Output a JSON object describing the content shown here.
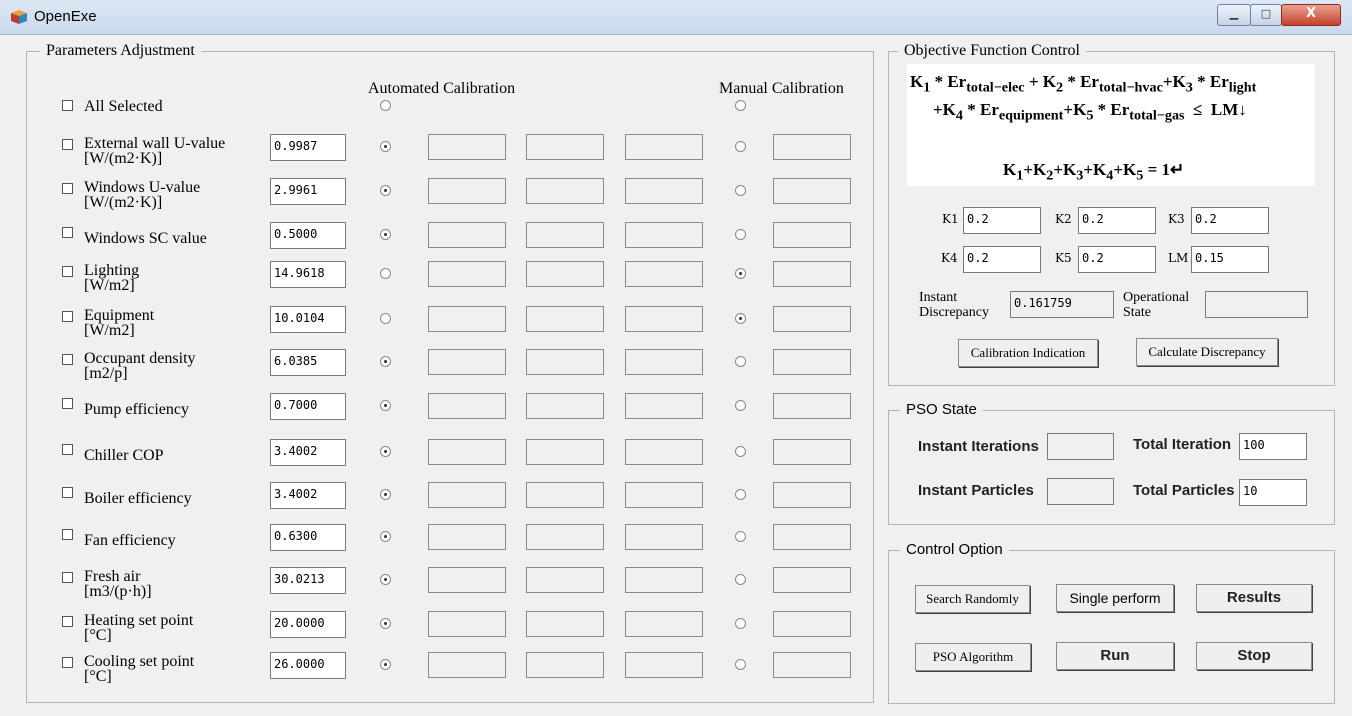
{
  "window": {
    "title": "OpenExe",
    "min_glyph": "▁",
    "max_glyph": "□",
    "close_glyph": "X"
  },
  "params": {
    "group_title": "Parameters Adjustment",
    "auto_header": "Automated Calibration",
    "manual_header": "Manual Calibration",
    "all_selected": "All Selected",
    "rows": [
      {
        "label": "External wall U-value",
        "unit": "[W/(m2·K)]",
        "value": "0.9987",
        "auto": true
      },
      {
        "label": "Windows U-value",
        "unit": "[W/(m2·K)]",
        "value": "2.9961",
        "auto": true
      },
      {
        "label": "Windows SC value",
        "unit": "",
        "value": "0.5000",
        "auto": true
      },
      {
        "label": "Lighting",
        "unit": "[W/m2]",
        "value": "14.9618",
        "auto": false
      },
      {
        "label": "Equipment",
        "unit": "[W/m2]",
        "value": "10.0104",
        "auto": false
      },
      {
        "label": "Occupant density",
        "unit": "[m2/p]",
        "value": "6.0385",
        "auto": true
      },
      {
        "label": "Pump efficiency",
        "unit": "",
        "value": "0.7000",
        "auto": true
      },
      {
        "label": "Chiller COP",
        "unit": "",
        "value": "3.4002",
        "auto": true
      },
      {
        "label": "Boiler efficiency",
        "unit": "",
        "value": "3.4002",
        "auto": true
      },
      {
        "label": "Fan efficiency",
        "unit": "",
        "value": "0.6300",
        "auto": true
      },
      {
        "label": "Fresh air",
        "unit": "[m3/(p·h)]",
        "value": "30.0213",
        "auto": true
      },
      {
        "label": "Heating set point",
        "unit": "[°C]",
        "value": "20.0000",
        "auto": true
      },
      {
        "label": "Cooling set point",
        "unit": "[°C]",
        "value": "26.0000",
        "auto": true
      }
    ]
  },
  "objective": {
    "group_title": "Objective Function Control",
    "formula": {
      "line1": "K₁ * Er_total−elec + K₂ * Er_total−hvac + K₃ * Er_light",
      "line2": "+K₄ * Er_equipment + K₅ * Er_total−gas ≤ LM↓",
      "line3": "K₁+K₂+K₃+K₄+K₅ = 1↵"
    },
    "k1_label": "K1",
    "k1": "0.2",
    "k2_label": "K2",
    "k2": "0.2",
    "k3_label": "K3",
    "k3": "0.2",
    "k4_label": "K4",
    "k4": "0.2",
    "k5_label": "K5",
    "k5": "0.2",
    "lm_label": "LM",
    "lm": "0.15",
    "instant_discrepancy_label_1": "Instant",
    "instant_discrepancy_label_2": "Discrepancy",
    "instant_discrepancy": "0.161759",
    "operational_state_label_1": "Operational",
    "operational_state_label_2": "State",
    "operational_state": "",
    "calibration_indication": "Calibration Indication",
    "calculate_discrepancy": "Calculate Discrepancy"
  },
  "pso": {
    "group_title": "PSO State",
    "instant_iterations_label": "Instant Iterations",
    "instant_iterations": "",
    "total_iteration_label": "Total Iteration",
    "total_iteration": "100",
    "instant_particles_label": "Instant Particles",
    "instant_particles": "",
    "total_particles_label": "Total Particles",
    "total_particles": "10"
  },
  "control": {
    "group_title": "Control Option",
    "search_randomly": "Search Randomly",
    "single_perform": "Single perform",
    "results": "Results",
    "pso_algorithm": "PSO Algorithm",
    "run": "Run",
    "stop": "Stop"
  }
}
